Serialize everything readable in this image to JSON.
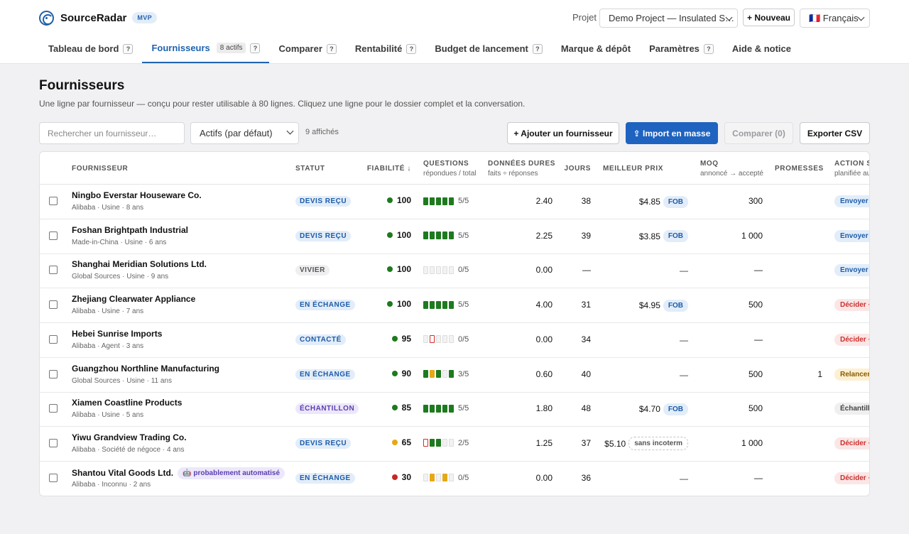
{
  "app": {
    "name": "SourceRadar",
    "badge": "MVP"
  },
  "header": {
    "project_label": "Projet",
    "project_value": "Demo Project — Insulated S…",
    "new_label": "+ Nouveau",
    "language_value": "🇫🇷 Français"
  },
  "tabs": [
    {
      "label": "Tableau de bord",
      "help": "?"
    },
    {
      "label": "Fournisseurs",
      "count": "8 actifs",
      "help": "?"
    },
    {
      "label": "Comparer",
      "help": "?"
    },
    {
      "label": "Rentabilité",
      "help": "?"
    },
    {
      "label": "Budget de lancement",
      "help": "?"
    },
    {
      "label": "Marque & dépôt"
    },
    {
      "label": "Paramètres",
      "help": "?"
    },
    {
      "label": "Aide & notice"
    }
  ],
  "page": {
    "title": "Fournisseurs",
    "subtitle": "Une ligne par fournisseur — conçu pour rester utilisable à 80 lignes. Cliquez une ligne pour le dossier complet et la conversation."
  },
  "toolbar": {
    "search_placeholder": "Rechercher un fournisseur…",
    "filter_value": "Actifs (par défaut)",
    "shown_count": "9 affichés",
    "add_label": "+ Ajouter un fournisseur",
    "import_label": "⇪ Import en masse",
    "compare_label": "Comparer (0)",
    "export_label": "Exporter CSV"
  },
  "columns": {
    "supplier": "FOURNISSEUR",
    "status": "STATUT",
    "reliability": "FIABILITÉ ↓",
    "questions": "QUESTIONS",
    "questions_sub": "répondues / total",
    "hard_data": "DONNÉES DURES",
    "hard_data_sub": "faits ÷ réponses",
    "days": "JOURS",
    "best_price": "MEILLEUR PRIX",
    "moq": "MOQ",
    "moq_sub": "annoncé → accepté",
    "promises": "PROMESSES",
    "action": "ACTION S",
    "action_sub": "planifiée au"
  },
  "colors": {
    "accent": "#1f63b0",
    "green": "#1e7a1e",
    "amber": "#e6a817",
    "red": "#c62828"
  },
  "rows": [
    {
      "name": "Ningbo Everstar Houseware Co.",
      "meta": "Alibaba · Usine · 8 ans",
      "status": "DEVIS REÇU",
      "status_style": "blue",
      "reliability": "100",
      "rel_color": "#1e7a1e",
      "segments": [
        "g",
        "g",
        "g",
        "g",
        "g"
      ],
      "questions": "5/5",
      "hard": "2.40",
      "days": "38",
      "price": "$4.85",
      "incoterm": "FOB",
      "incoterm_style": "fob",
      "moq": "300",
      "promises": "",
      "action": "Envoyer",
      "action_style": "blue"
    },
    {
      "name": "Foshan Brightpath Industrial",
      "meta": "Made-in-China · Usine · 6 ans",
      "status": "DEVIS REÇU",
      "status_style": "blue",
      "reliability": "100",
      "rel_color": "#1e7a1e",
      "segments": [
        "g",
        "g",
        "g",
        "g",
        "g"
      ],
      "questions": "5/5",
      "hard": "2.25",
      "days": "39",
      "price": "$3.85",
      "incoterm": "FOB",
      "incoterm_style": "fob",
      "moq": "1 000",
      "promises": "",
      "action": "Envoyer",
      "action_style": "blue"
    },
    {
      "name": "Shanghai Meridian Solutions Ltd.",
      "meta": "Global Sources · Usine · 9 ans",
      "status": "VIVIER",
      "status_style": "gray",
      "reliability": "100",
      "rel_color": "#1e7a1e",
      "segments": [
        "e",
        "e",
        "e",
        "e",
        "e"
      ],
      "questions": "0/5",
      "hard": "0.00",
      "days": "—",
      "price": "—",
      "incoterm": "",
      "incoterm_style": "",
      "moq": "—",
      "promises": "",
      "action": "Envoyer",
      "action_style": "blue"
    },
    {
      "name": "Zhejiang Clearwater Appliance",
      "meta": "Alibaba · Usine · 7 ans",
      "status": "EN ÉCHANGE",
      "status_style": "blue",
      "reliability": "100",
      "rel_color": "#1e7a1e",
      "segments": [
        "g",
        "g",
        "g",
        "g",
        "g"
      ],
      "questions": "5/5",
      "hard": "4.00",
      "days": "31",
      "price": "$4.95",
      "incoterm": "FOB",
      "incoterm_style": "fob",
      "moq": "500",
      "promises": "",
      "action": "Décider ·",
      "action_style": "red"
    },
    {
      "name": "Hebei Sunrise Imports",
      "meta": "Alibaba · Agent · 3 ans",
      "status": "CONTACTÉ",
      "status_style": "blue",
      "reliability": "95",
      "rel_color": "#1e7a1e",
      "segments": [
        "e",
        "r",
        "e",
        "e",
        "e"
      ],
      "questions": "0/5",
      "hard": "0.00",
      "days": "34",
      "price": "—",
      "incoterm": "",
      "incoterm_style": "",
      "moq": "—",
      "promises": "",
      "action": "Décider ·",
      "action_style": "red"
    },
    {
      "name": "Guangzhou Northline Manufacturing",
      "meta": "Global Sources · Usine · 11 ans",
      "status": "EN ÉCHANGE",
      "status_style": "blue",
      "reliability": "90",
      "rel_color": "#1e7a1e",
      "segments": [
        "g",
        "y",
        "g",
        "e",
        "g"
      ],
      "questions": "3/5",
      "hard": "0.60",
      "days": "40",
      "price": "—",
      "incoterm": "",
      "incoterm_style": "",
      "moq": "500",
      "promises": "1",
      "action": "Relancer",
      "action_style": "amber"
    },
    {
      "name": "Xiamen Coastline Products",
      "meta": "Alibaba · Usine · 5 ans",
      "status": "ÉCHANTILLON",
      "status_style": "purple",
      "reliability": "85",
      "rel_color": "#1e7a1e",
      "segments": [
        "g",
        "g",
        "g",
        "g",
        "g"
      ],
      "questions": "5/5",
      "hard": "1.80",
      "days": "48",
      "price": "$4.70",
      "incoterm": "FOB",
      "incoterm_style": "fob",
      "moq": "500",
      "promises": "",
      "action": "Échantill",
      "action_style": "gray"
    },
    {
      "name": "Yiwu Grandview Trading Co.",
      "meta": "Alibaba · Société de négoce · 4 ans",
      "status": "DEVIS REÇU",
      "status_style": "blue",
      "reliability": "65",
      "rel_color": "#e6a817",
      "segments": [
        "r",
        "g",
        "g",
        "e",
        "e"
      ],
      "questions": "2/5",
      "hard": "1.25",
      "days": "37",
      "price": "$5.10",
      "incoterm": "sans incoterm",
      "incoterm_style": "none",
      "moq": "1 000",
      "promises": "",
      "action": "Décider ·",
      "action_style": "red"
    },
    {
      "name": "Shantou Vital Goods Ltd.",
      "auto_badge": "🤖 probablement automatisé",
      "meta": "Alibaba · Inconnu · 2 ans",
      "status": "EN ÉCHANGE",
      "status_style": "blue",
      "reliability": "30",
      "rel_color": "#c62828",
      "segments": [
        "e",
        "y",
        "e",
        "y",
        "e"
      ],
      "questions": "0/5",
      "hard": "0.00",
      "days": "36",
      "price": "—",
      "incoterm": "",
      "incoterm_style": "",
      "moq": "—",
      "promises": "",
      "action": "Décider ·",
      "action_style": "red"
    }
  ]
}
